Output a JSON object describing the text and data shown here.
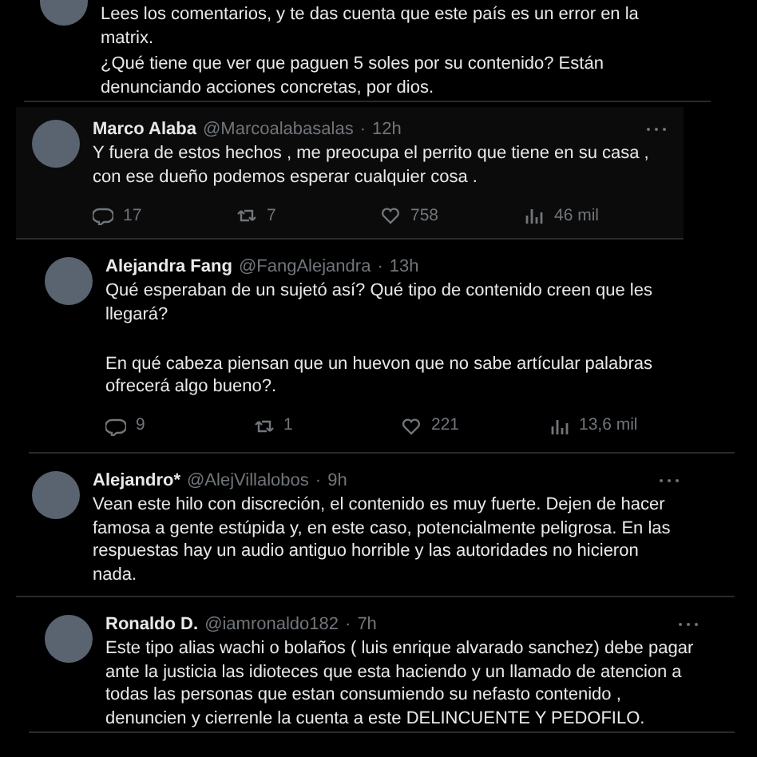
{
  "tweets": [
    {
      "body": [
        {
          "text": "Lees los comentarios, y te das cuenta que este país es un error en la matrix.",
          "spaced": false
        },
        {
          "text": "¿Qué tiene que ver que paguen 5 soles por su contenido? Están denunciando acciones concretas, por dios.",
          "spaced": false
        }
      ]
    },
    {
      "name": "Marco Alaba",
      "handle": "@Marcoalabasalas",
      "separator": "·",
      "time": "12h",
      "more": true,
      "body": [
        {
          "text": "Y fuera de estos hechos , me preocupa el perrito que tiene en su casa , con ese dueño podemos esperar cualquier cosa .",
          "spaced": false
        }
      ],
      "stats": {
        "replies": "17",
        "reposts": "7",
        "likes": "758",
        "views": "46 mil"
      }
    },
    {
      "name": "Alejandra Fang",
      "handle": "@FangAlejandra",
      "separator": "·",
      "time": "13h",
      "more": false,
      "body": [
        {
          "text": "Qué esperaban de un sujetó así? Qué tipo de contenido creen que les llegará?",
          "spaced": false
        },
        {
          "text": "En qué cabeza piensan que un huevon que no sabe artícular palabras ofrecerá algo bueno?.",
          "spaced": true
        }
      ],
      "stats": {
        "replies": "9",
        "reposts": "1",
        "likes": "221",
        "views": "13,6 mil"
      }
    },
    {
      "name": "Alejandro*",
      "handle": "@AlejVillalobos",
      "separator": "·",
      "time": "9h",
      "more": true,
      "body": [
        {
          "text": "Vean este hilo con discreción, el contenido es muy fuerte. Dejen de hacer famosa a gente estúpida y, en este caso, potencialmente peligrosa. En las respuestas hay un audio antiguo horrible y las autoridades no hicieron nada.",
          "spaced": false
        }
      ]
    },
    {
      "name": "Ronaldo D.",
      "handle": "@iamronaldo182",
      "separator": "·",
      "time": "7h",
      "more": true,
      "body": [
        {
          "text": "Este tipo alias wachi o bolaños ( luis enrique alvarado sanchez) debe pagar ante la justicia las idioteces que esta haciendo y un llamado de atencion a todas las personas que estan consumiendo su nefasto contenido , denuncien y cierrenle la cuenta a este DELINCUENTE Y PEDOFILO.",
          "spaced": false
        }
      ]
    }
  ]
}
